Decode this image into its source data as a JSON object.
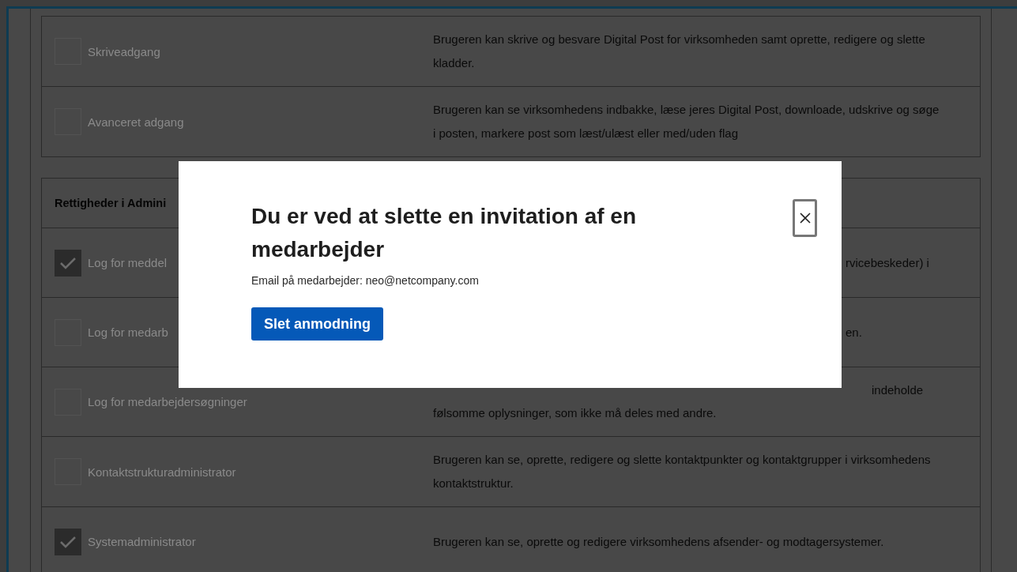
{
  "sections": [
    {
      "rows": [
        {
          "label": "Skriveadgang",
          "checked": false,
          "description": {
            "text": "Brugeren kan skrive og besvare Digital Post for virksomheden samt oprette, redigere og slette kladder."
          }
        },
        {
          "label": "Avanceret adgang",
          "checked": false,
          "description": {
            "text": "Brugeren kan se virksomhedens indbakke, læse jeres Digital Post, downloade, udskrive og søge i posten, markere post som læst/ulæst eller med/uden flag"
          }
        }
      ]
    },
    {
      "heading": "Rettigheder i Admini",
      "rows": [
        {
          "label": "Log for meddel",
          "checked": true,
          "description": {
            "text": "rvicebeskeder) i",
            "covered": true
          }
        },
        {
          "label": "Log for medarb",
          "checked": false,
          "description": {
            "text": "en.",
            "covered": true
          }
        },
        {
          "label": "Log for medarbejdersøgninger",
          "checked": false,
          "description": {
            "text": "følsomme oplysninger, som ikke må deles med andre.",
            "tail": "indeholde"
          }
        },
        {
          "label": "Kontaktstrukturadministrator",
          "checked": false,
          "description": {
            "text": "Brugeren kan se, oprette, redigere og slette kontaktpunkter og kontaktgrupper i virksomhedens kontaktstruktur."
          }
        },
        {
          "label": "Systemadministrator",
          "checked": true,
          "description": {
            "text": "Brugeren kan se, oprette og redigere virksomhedens afsender- og modtagersystemer."
          }
        }
      ]
    }
  ],
  "modal": {
    "title": "Du er ved at slette en invitation af en medarbejder",
    "email_line": "Email på medarbejder: neo@netcompany.com",
    "button": "Slet anmodning"
  }
}
